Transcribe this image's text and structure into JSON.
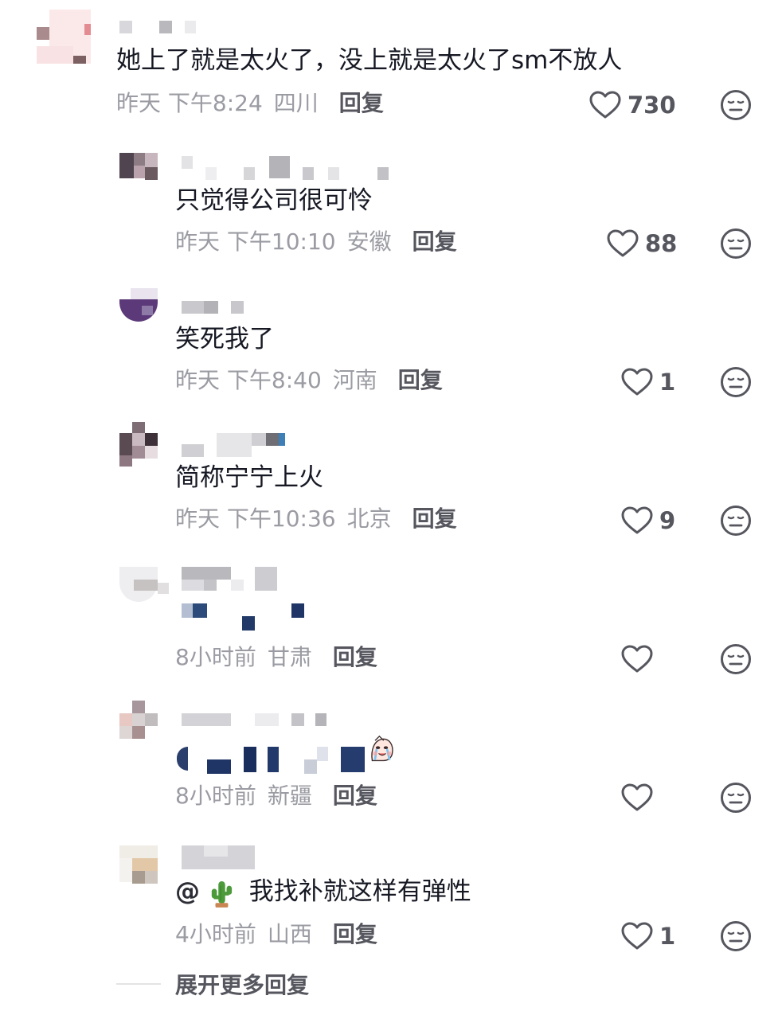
{
  "comments": [
    {
      "text": "她上了就是太火了，没上就是太火了sm不放人",
      "time": "昨天 下午8:24",
      "location": "四川",
      "reply_label": "回复",
      "likes": "730"
    },
    {
      "text": "只觉得公司很可怜",
      "time": "昨天 下午10:10",
      "location": "安徽",
      "reply_label": "回复",
      "likes": "88"
    },
    {
      "text": "笑死我了",
      "time": "昨天 下午8:40",
      "location": "河南",
      "reply_label": "回复",
      "likes": "1"
    },
    {
      "text": "简称宁宁上火",
      "time": "昨天 下午10:36",
      "location": "北京",
      "reply_label": "回复",
      "likes": "9"
    },
    {
      "text": "",
      "time": "8小时前",
      "location": "甘肃",
      "reply_label": "回复",
      "likes": ""
    },
    {
      "text": "",
      "time": "8小时前",
      "location": "新疆",
      "reply_label": "回复",
      "likes": ""
    },
    {
      "mention": "@",
      "text": "我找补就这样有弹性",
      "time": "4小时前",
      "location": "山西",
      "reply_label": "回复",
      "likes": "1"
    }
  ],
  "expand_more_label": "展开更多回复",
  "icons": {
    "like": "heart-outline-icon",
    "dislike": "neutral-face-icon",
    "cactus": "cactus-emoji"
  },
  "colors": {
    "text": "#161823",
    "meta": "#9b9ca3",
    "reply": "#55565e",
    "icon": "#55565e"
  }
}
